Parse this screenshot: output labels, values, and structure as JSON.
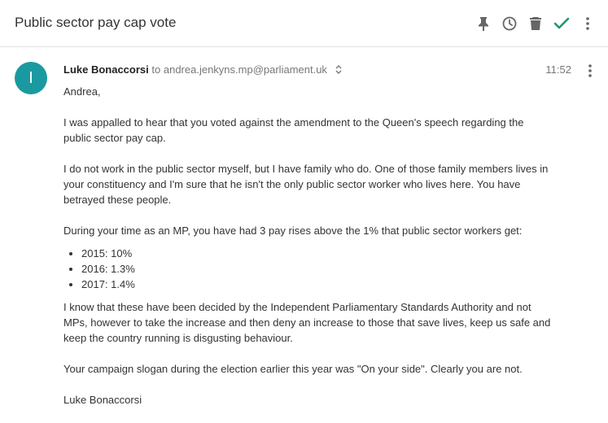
{
  "header": {
    "subject": "Public sector pay cap vote",
    "icons": [
      "pin-icon",
      "snooze-clock-icon",
      "trash-icon",
      "check-icon",
      "more-vert-icon"
    ],
    "check_color": "#1a9a6a"
  },
  "message": {
    "avatar_initial": "I",
    "avatar_color": "#1a9aa0",
    "sender": "Luke Bonaccorsi",
    "to_label": "to",
    "recipient": "andrea.jenkyns.mp@parliament.uk",
    "time": "11:52",
    "greeting": "Andrea,",
    "paragraphs": [
      "I was appalled to hear that you voted against the amendment to the Queen's speech regarding the public sector pay cap.",
      "I do not work in the public sector myself, but I have family who do. One of those family members lives in your constituency and I'm sure that he isn't the only public sector worker who lives here. You have betrayed these people.",
      "During your time as an MP, you have had 3 pay rises above the 1% that public sector workers get:"
    ],
    "list": [
      "2015: 10%",
      "2016: 1.3%",
      "2017: 1.4%"
    ],
    "paragraphs_after": [
      "I know that these have been decided by the Independent Parliamentary Standards Authority and not MPs, however to take the increase and then deny an increase to those that save lives, keep us safe and keep the country running is disgusting behaviour.",
      "Your campaign slogan during the election earlier this year was \"On your side\". Clearly you are not."
    ],
    "signature": "Luke Bonaccorsi"
  }
}
